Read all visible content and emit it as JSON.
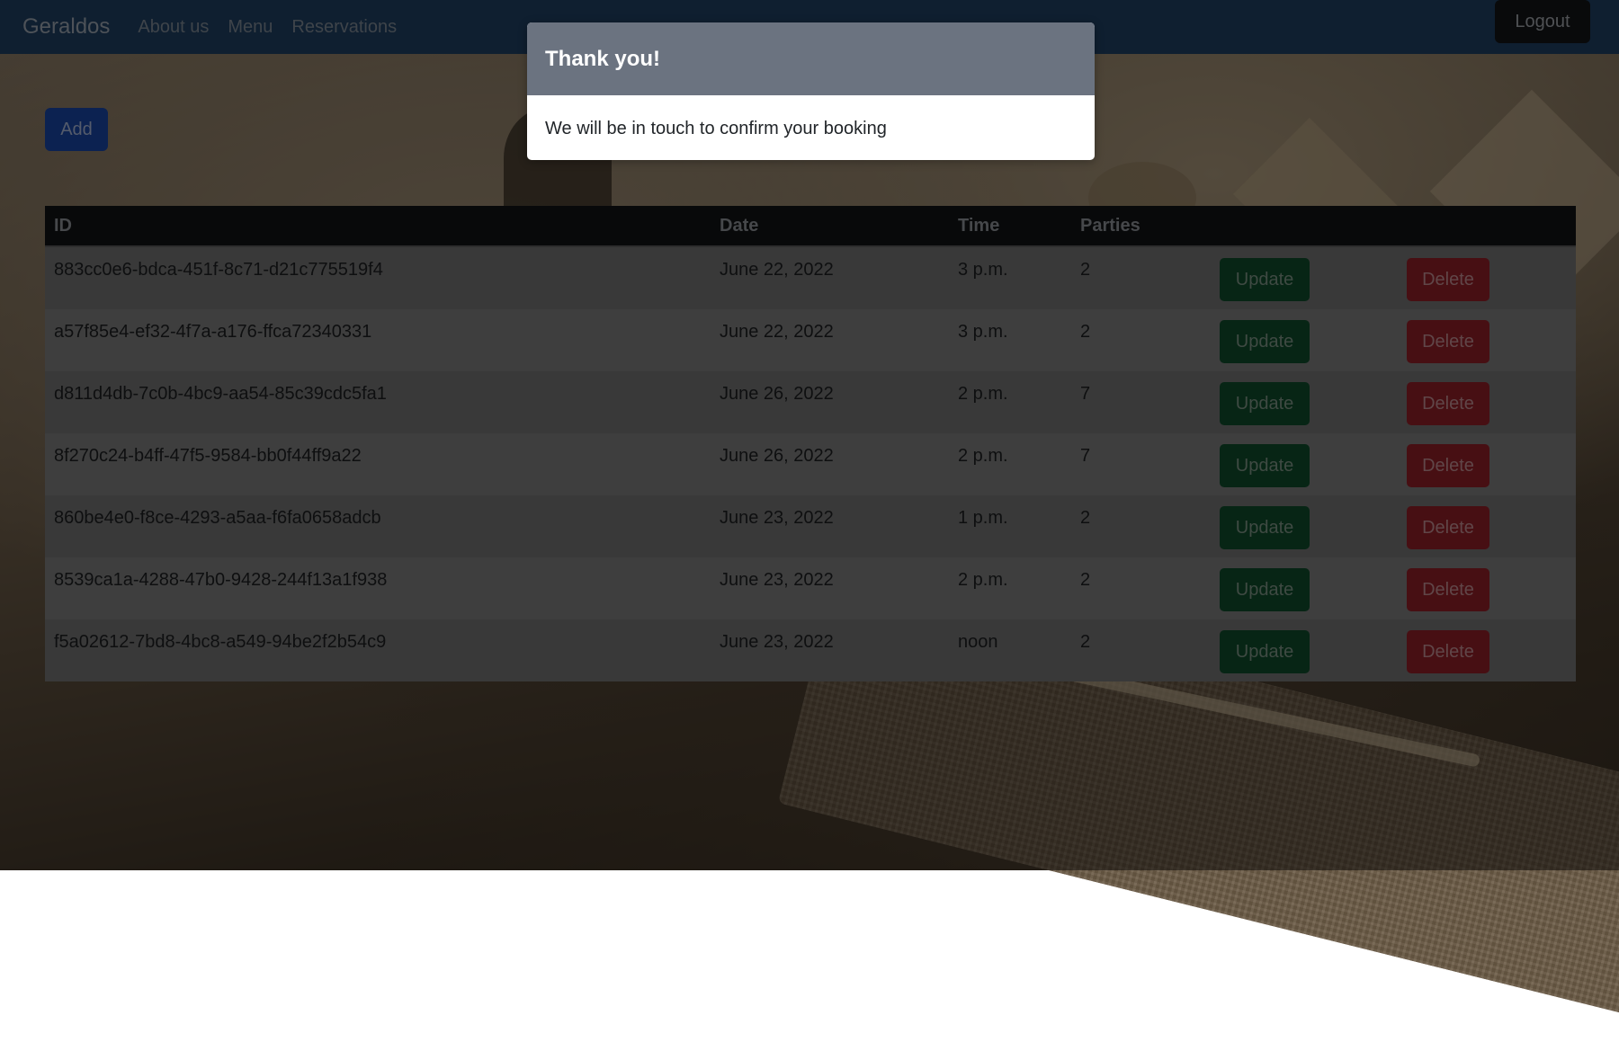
{
  "navbar": {
    "brand": "Geraldos",
    "links": [
      "About us",
      "Menu",
      "Reservations"
    ],
    "logout": "Logout"
  },
  "actions": {
    "add": "Add"
  },
  "table": {
    "headers": [
      "ID",
      "Date",
      "Time",
      "Parties"
    ],
    "rows": [
      {
        "id": "883cc0e6-bdca-451f-8c71-d21c775519f4",
        "date": "June 22, 2022",
        "time": "3 p.m.",
        "parties": "2"
      },
      {
        "id": "a57f85e4-ef32-4f7a-a176-ffca72340331",
        "date": "June 22, 2022",
        "time": "3 p.m.",
        "parties": "2"
      },
      {
        "id": "d811d4db-7c0b-4bc9-aa54-85c39cdc5fa1",
        "date": "June 26, 2022",
        "time": "2 p.m.",
        "parties": "7"
      },
      {
        "id": "8f270c24-b4ff-47f5-9584-bb0f44ff9a22",
        "date": "June 26, 2022",
        "time": "2 p.m.",
        "parties": "7"
      },
      {
        "id": "860be4e0-f8ce-4293-a5aa-f6fa0658adcb",
        "date": "June 23, 2022",
        "time": "1 p.m.",
        "parties": "2"
      },
      {
        "id": "8539ca1a-4288-47b0-9428-244f13a1f938",
        "date": "June 23, 2022",
        "time": "2 p.m.",
        "parties": "2"
      },
      {
        "id": "f5a02612-7bd8-4bc8-a549-94be2f2b54c9",
        "date": "June 23, 2022",
        "time": "noon",
        "parties": "2"
      }
    ],
    "update_label": "Update",
    "delete_label": "Delete"
  },
  "modal": {
    "title": "Thank you!",
    "message": "We will be in touch to confirm your booking"
  },
  "colors": {
    "navbar": "#1f3e60",
    "add_button": "#1845a3",
    "update_button": "#0e4a2a",
    "delete_button": "#8e1e27",
    "modal_header": "#6b7380"
  }
}
